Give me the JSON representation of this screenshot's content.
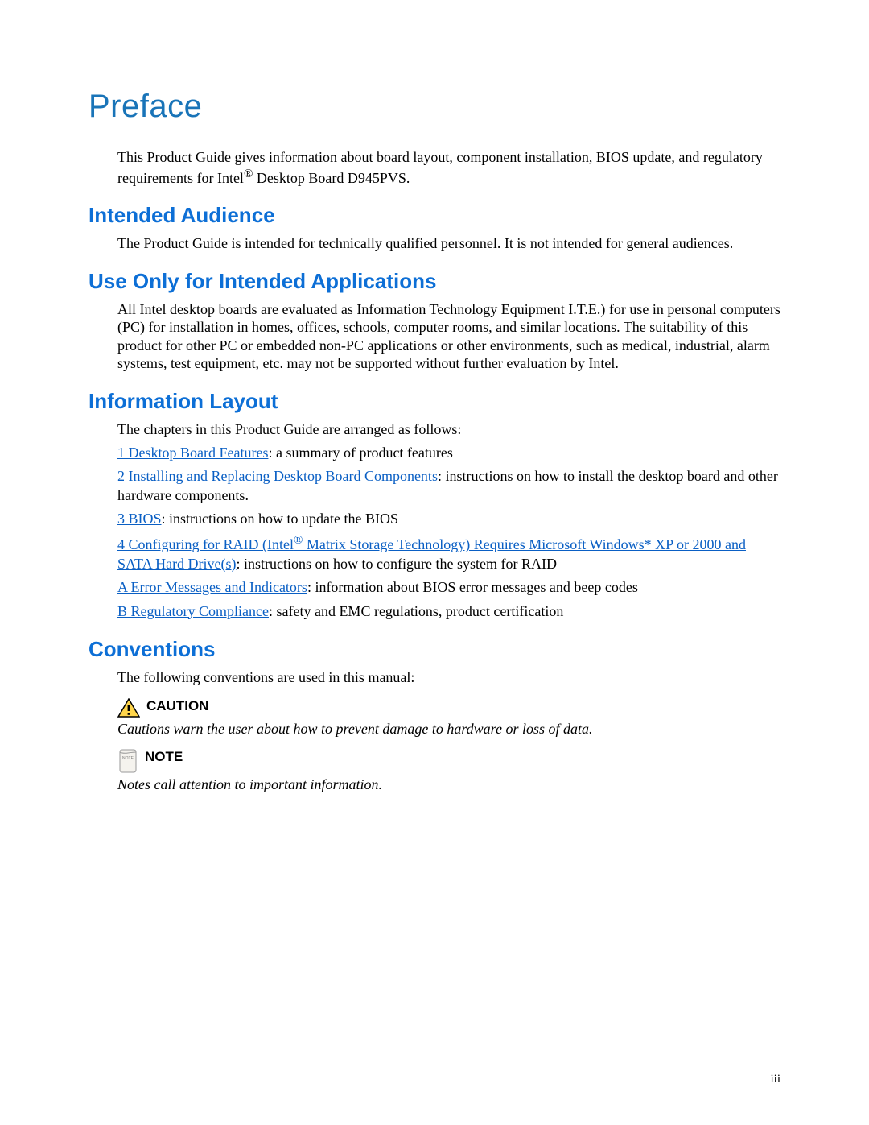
{
  "title": "Preface",
  "intro_part1": "This Product Guide gives information about board layout, component installation, BIOS update, and regulatory requirements for Intel",
  "intro_reg": "®",
  "intro_part2": " Desktop Board D945PVS.",
  "sections": {
    "audience": {
      "heading": "Intended Audience",
      "body": "The Product Guide is intended for technically qualified personnel.  It is not intended for general audiences."
    },
    "use_only": {
      "heading": "Use Only for Intended Applications",
      "body": "All Intel desktop boards are evaluated as Information Technology Equipment I.T.E.) for use in personal computers (PC) for installation in homes, offices, schools, computer rooms, and similar locations. The suitability of this product for other PC or embedded non-PC applications or other environments, such as medical, industrial, alarm systems, test equipment, etc. may not be supported without further evaluation by Intel."
    },
    "layout": {
      "heading": "Information Layout",
      "intro": "The chapters in this Product Guide are arranged as follows:",
      "items": [
        {
          "link": "1  Desktop Board Features",
          "rest": ":  a summary of product features"
        },
        {
          "link": "2  Installing and Replacing Desktop Board Components",
          "rest": ":  instructions on how to install the desktop board and other hardware components."
        },
        {
          "link": "3  BIOS",
          "rest": ":  instructions on how to update the BIOS"
        },
        {
          "link_pre": "4  Configuring for RAID (Intel",
          "reg": "®",
          "link_post": " Matrix Storage Technology) Requires Microsoft Windows* XP or 2000 and SATA Hard Drive(s)",
          "rest": ":  instructions on how to configure the system for RAID"
        },
        {
          "link": "A  Error Messages and Indicators",
          "rest": ":  information about BIOS error messages and beep codes"
        },
        {
          "link": "B  Regulatory Compliance",
          "rest": ":  safety and EMC regulations, product certification"
        }
      ]
    },
    "conventions": {
      "heading": "Conventions",
      "intro": "The following conventions are used in this manual:",
      "caution_label": "CAUTION",
      "caution_text": "Cautions warn the user about how to prevent damage to hardware or loss of data.",
      "note_label": "NOTE",
      "note_text": "Notes call attention to important information."
    }
  },
  "page_number": "iii"
}
